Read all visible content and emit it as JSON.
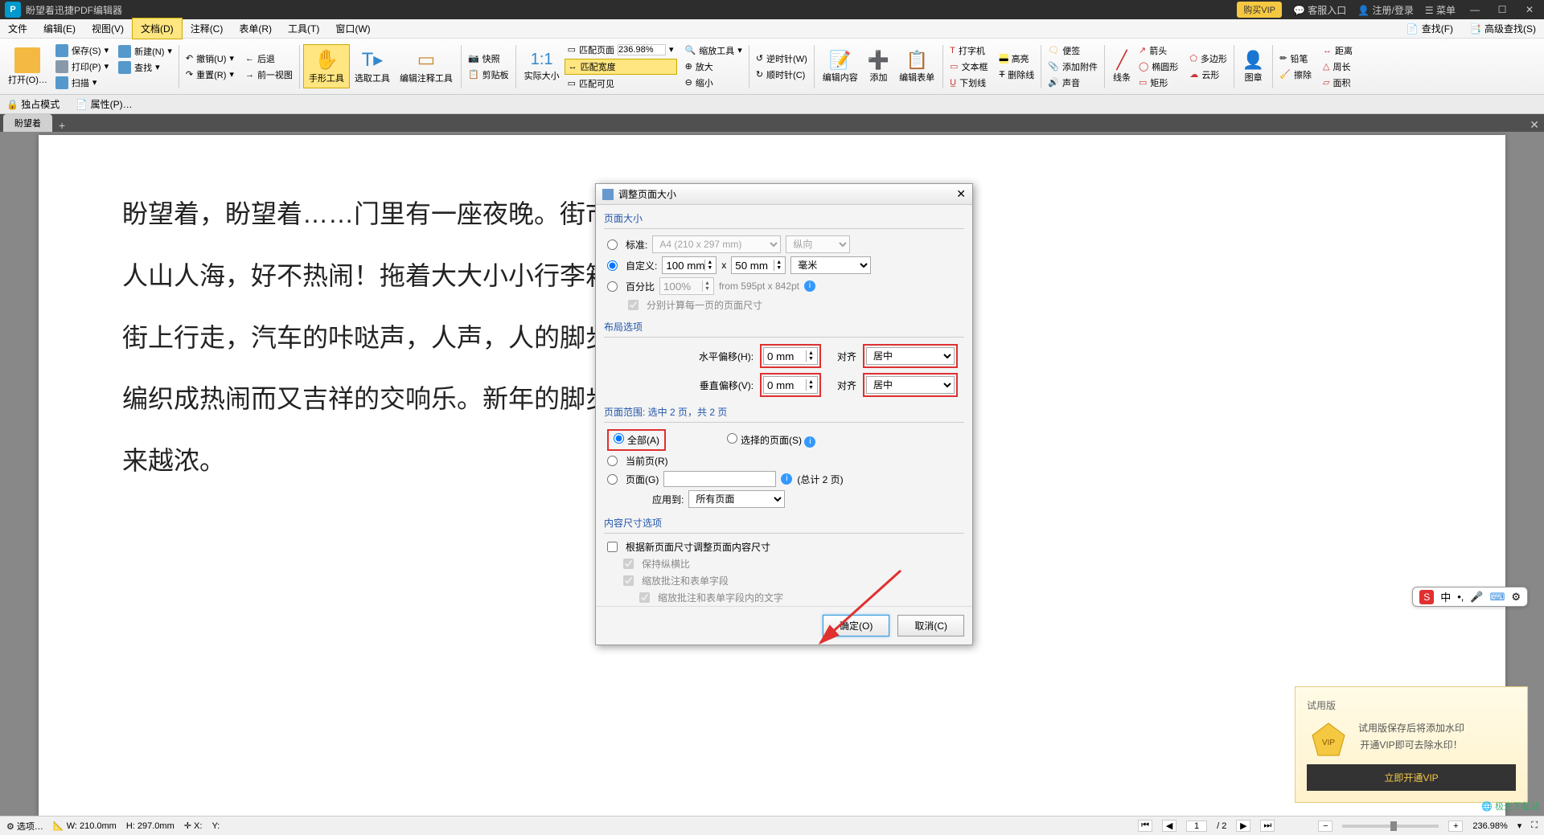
{
  "titlebar": {
    "app_prefix": "P",
    "title": "盼望着迅捷PDF编辑器",
    "vip": "购买VIP",
    "support": "客服入口",
    "login": "注册/登录",
    "menu": "菜单"
  },
  "menubar": {
    "items": [
      "文件",
      "编辑(E)",
      "视图(V)",
      "文档(D)",
      "注释(C)",
      "表单(R)",
      "工具(T)",
      "窗口(W)"
    ],
    "active_index": 3,
    "find": "查找(F)",
    "advfind": "高级查找(S)"
  },
  "ribbon": {
    "open": "打开(O)…",
    "save": "保存(S)",
    "print": "打印(P)",
    "scan": "扫描",
    "new": "新建(N)",
    "find": "查找",
    "undo": "撤销(U)",
    "redo": "重置(R)",
    "back": "后退",
    "forward": "前一视图",
    "hand": "手形工具",
    "select": "选取工具",
    "annot": "编辑注释工具",
    "snapshot": "快照",
    "clipboard": "剪贴板",
    "actual": "实际大小",
    "fit_page": "匹配页面",
    "zoom": "236.98%",
    "fit_width": "匹配宽度",
    "fit_visible": "匹配可见",
    "zoom_tool": "缩放工具",
    "zoom_in": "放大",
    "zoom_out": "缩小",
    "rotate_cw": "逆时针(W)",
    "rotate_ccw": "顺时针(C)",
    "edit_content": "编辑内容",
    "add": "添加",
    "edit_form": "编辑表单",
    "typewriter": "打字机",
    "textbox": "文本框",
    "underline": "下划线",
    "highlight": "高亮",
    "strike": "删除线",
    "sticky": "便签",
    "attach": "添加附件",
    "sound": "声音",
    "line": "线条",
    "rect": "矩形",
    "arrow": "箭头",
    "ellipse": "椭圆形",
    "polygon": "多边形",
    "cloud": "云形",
    "stamp": "图章",
    "pencil": "铅笔",
    "eraser": "擦除",
    "ruler": "距离",
    "perimeter": "周长",
    "area": "面积"
  },
  "secbar": {
    "exclusive": "独占模式",
    "properties": "属性(P)…"
  },
  "tabbar": {
    "tab1": "盼望着"
  },
  "document": {
    "line1": "盼望着，盼望着……门里有一座夜晚。街市上车水马龙，",
    "line2": "人山人海，好不热闹！拖着大大小小行李箱的人在",
    "line3": "街上行走，汽车的咔哒声，人声，人的脚步声……",
    "line4": "编织成热闹而又吉祥的交响乐。新年的脚步近了，年味儿越",
    "line5": "来越浓。"
  },
  "dialog": {
    "title": "调整页面大小",
    "section_size": "页面大小",
    "standard": "标准:",
    "standard_val": "A4 (210 x 297 mm)",
    "orientation": "纵向",
    "custom": "自定义:",
    "custom_w": "100 mm",
    "custom_h": "50 mm",
    "unit": "毫米",
    "percent": "百分比",
    "percent_val": "100%",
    "from_label": "from 595pt x 842pt",
    "calc_each": "分别计算每一页的页面尺寸",
    "section_layout": "布局选项",
    "hoffset": "水平偏移(H):",
    "hoffset_val": "0 mm",
    "voffset": "垂直偏移(V):",
    "voffset_val": "0 mm",
    "align": "对齐",
    "align_val": "居中",
    "section_range": "页面范围: 选中 2 页，共 2 页",
    "all": "全部(A)",
    "selected": "选择的页面(S)",
    "current": "当前页(R)",
    "pages": "页面(G)",
    "total": "(总计 2 页)",
    "apply_to": "应用到:",
    "apply_val": "所有页面",
    "section_content": "内容尺寸选项",
    "resize_content": "根据新页面尺寸调整页面内容尺寸",
    "keep_ratio": "保持纵横比",
    "scale_annot": "缩放批注和表单字段",
    "scale_text": "缩放批注和表单字段内的文字",
    "ok": "确定(O)",
    "cancel": "取消(C)"
  },
  "trial": {
    "tag": "试用版",
    "line1": "试用版保存后将添加水印",
    "line2": "开通VIP即可去除水印！",
    "btn": "立即开通VIP"
  },
  "ime": {
    "lang": "中"
  },
  "statusbar": {
    "options": "选项…",
    "w": "W: 210.0mm",
    "h": "H: 297.0mm",
    "x": "X:",
    "y": "Y:",
    "page": "1",
    "total": "/ 2",
    "zoom": "236.98%"
  },
  "watermark": "极光下载站"
}
